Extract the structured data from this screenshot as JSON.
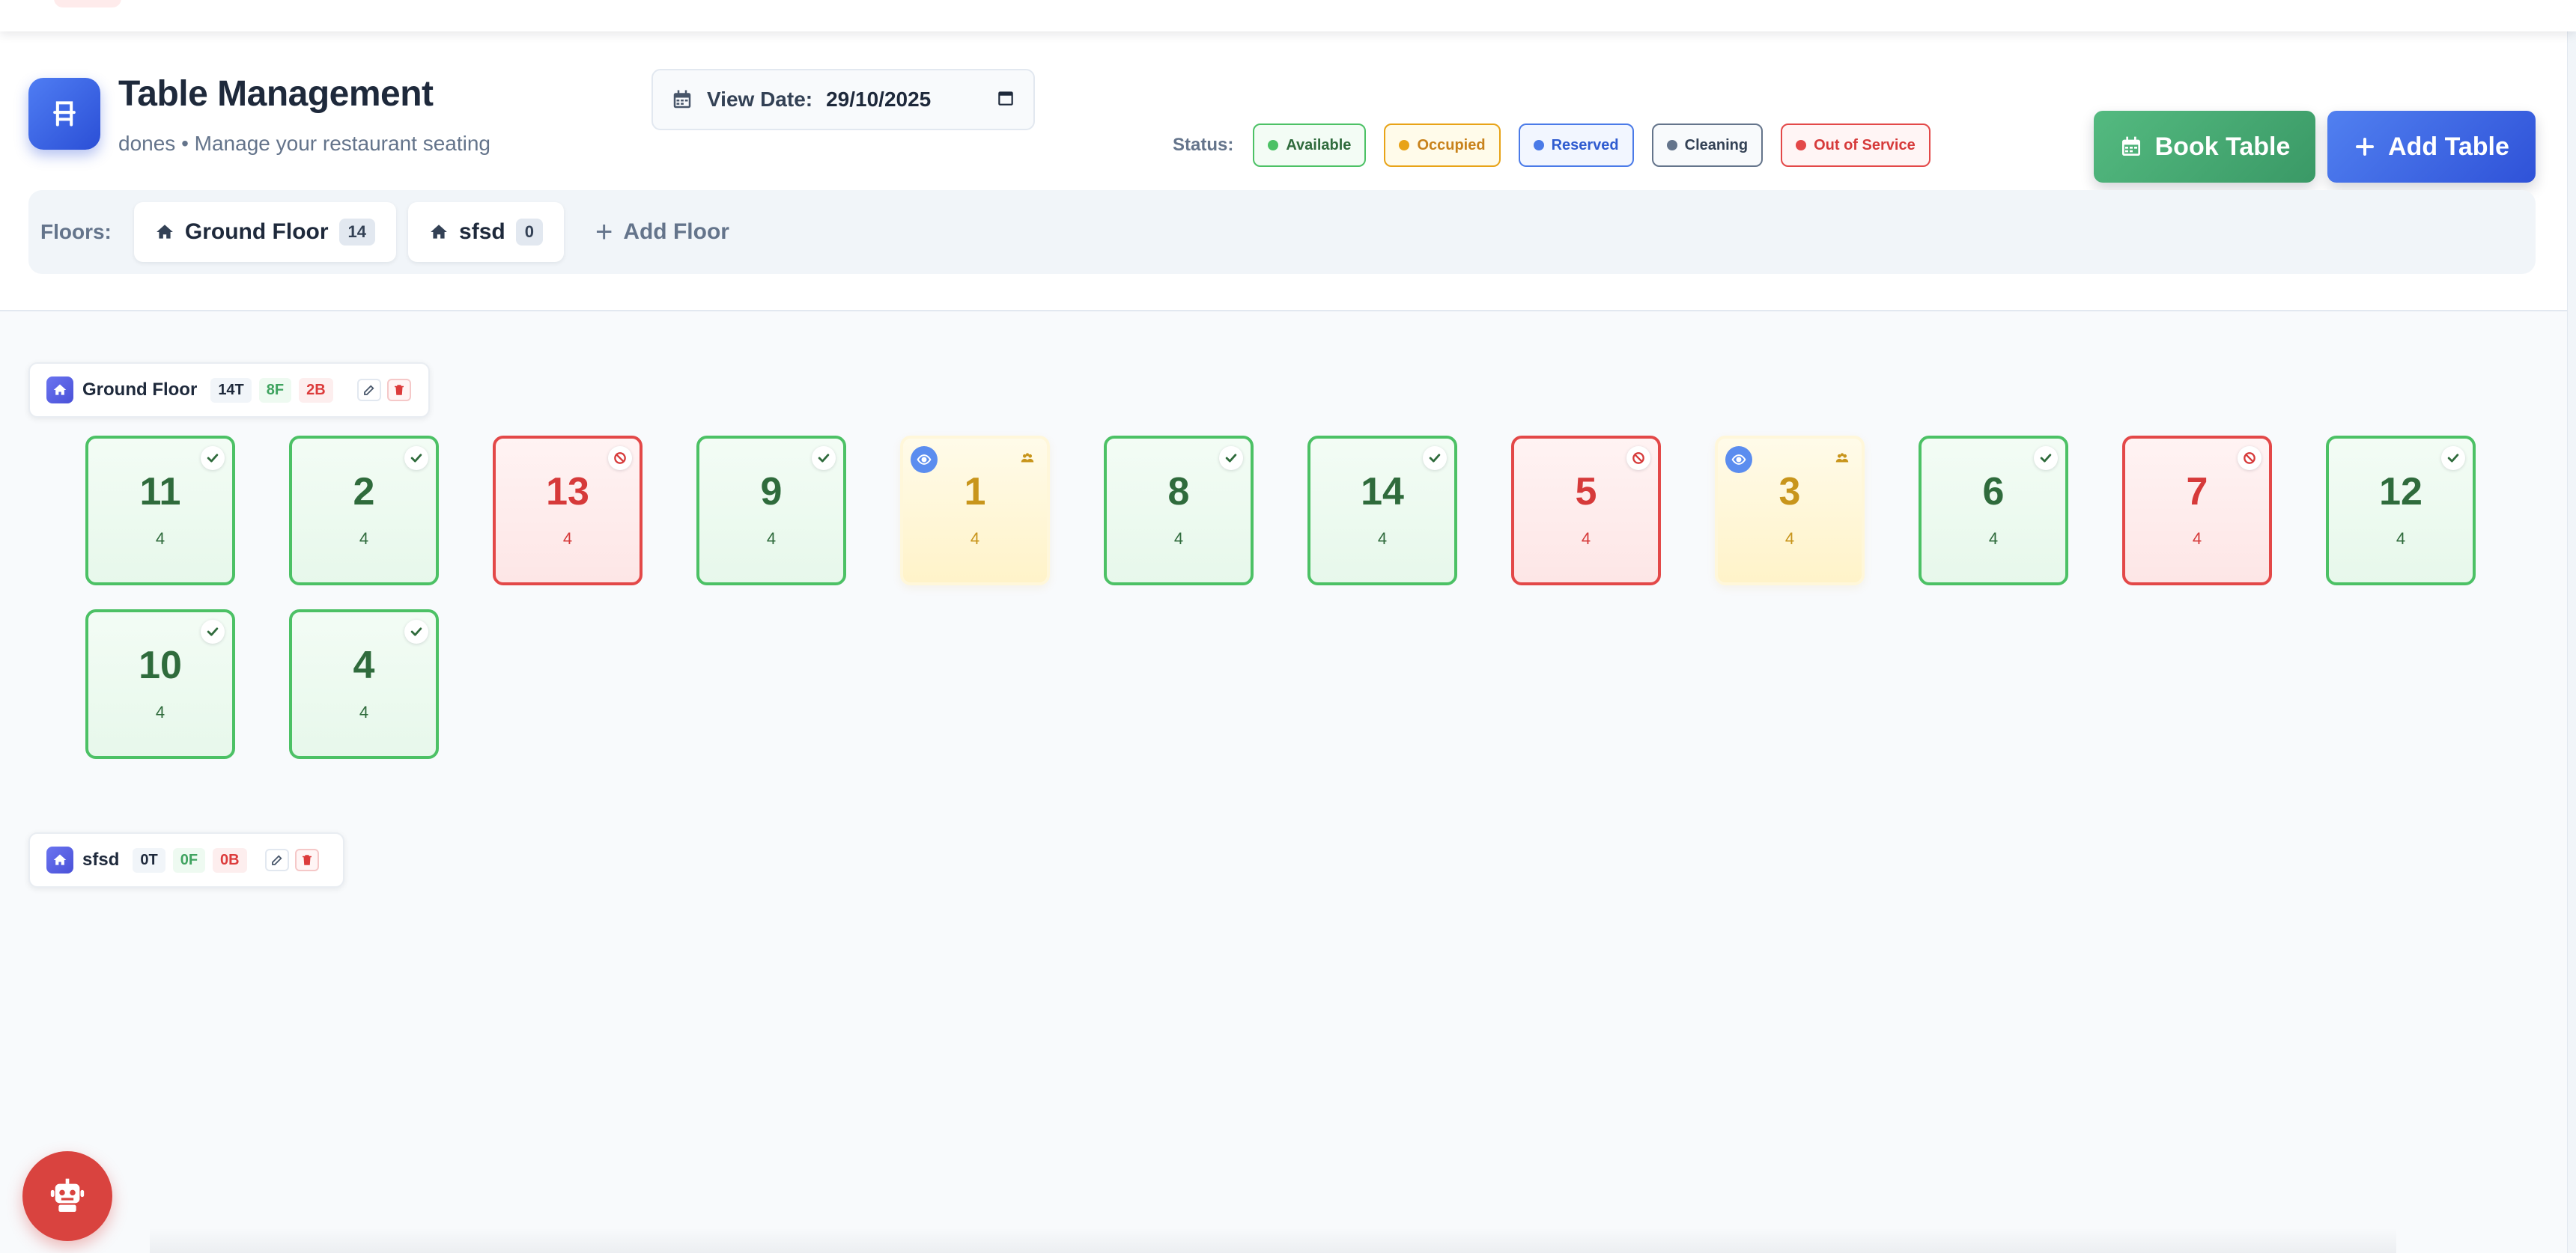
{
  "header": {
    "title": "Table Management",
    "subtitle": "dones • Manage your restaurant seating",
    "view_date_label": "View Date:",
    "view_date_value": "29/10/2025",
    "status_label": "Status:",
    "book_table_label": "Book Table",
    "add_table_label": "Add Table"
  },
  "status_legend": [
    {
      "label": "Available",
      "color": "#4cc165",
      "bg": "#f3fcf5",
      "text": "#2f6b3c"
    },
    {
      "label": "Occupied",
      "color": "#e8a317",
      "bg": "#fffbea",
      "text": "#c8821b"
    },
    {
      "label": "Reserved",
      "color": "#4a7ae8",
      "bg": "#f2f6ff",
      "text": "#2f5bd0"
    },
    {
      "label": "Cleaning",
      "color": "#64748b",
      "bg": "#f8fafc",
      "text": "#334155"
    },
    {
      "label": "Out of Service",
      "color": "#e34848",
      "bg": "#fff5f5",
      "text": "#d63a3a"
    }
  ],
  "floors_bar": {
    "label": "Floors:",
    "tabs": [
      {
        "name": "Ground Floor",
        "count": "14"
      },
      {
        "name": "sfsd",
        "count": "0"
      }
    ],
    "add_floor_label": "Add Floor"
  },
  "sections": [
    {
      "name": "Ground Floor",
      "total": "14T",
      "free": "8F",
      "busy": "2B",
      "tables": [
        {
          "number": "11",
          "capacity": "4",
          "status": "available"
        },
        {
          "number": "2",
          "capacity": "4",
          "status": "available"
        },
        {
          "number": "13",
          "capacity": "4",
          "status": "outofservice"
        },
        {
          "number": "9",
          "capacity": "4",
          "status": "available"
        },
        {
          "number": "1",
          "capacity": "4",
          "status": "occupied"
        },
        {
          "number": "8",
          "capacity": "4",
          "status": "available"
        },
        {
          "number": "14",
          "capacity": "4",
          "status": "available"
        },
        {
          "number": "5",
          "capacity": "4",
          "status": "outofservice"
        },
        {
          "number": "3",
          "capacity": "4",
          "status": "occupied"
        },
        {
          "number": "6",
          "capacity": "4",
          "status": "available"
        },
        {
          "number": "7",
          "capacity": "4",
          "status": "outofservice"
        },
        {
          "number": "12",
          "capacity": "4",
          "status": "available"
        },
        {
          "number": "10",
          "capacity": "4",
          "status": "available"
        },
        {
          "number": "4",
          "capacity": "4",
          "status": "available"
        }
      ]
    },
    {
      "name": "sfsd",
      "total": "0T",
      "free": "0F",
      "busy": "0B",
      "tables": []
    }
  ],
  "icons": {
    "logo": "chair-icon",
    "calendar": "calendar-icon",
    "book": "calendar-icon",
    "add": "plus-icon",
    "floor": "home-icon",
    "edit": "edit-icon",
    "delete": "trash-icon",
    "check": "check-icon",
    "blocked": "ban-icon",
    "view": "eye-icon",
    "guests": "users-icon",
    "assistant": "robot-icon"
  }
}
